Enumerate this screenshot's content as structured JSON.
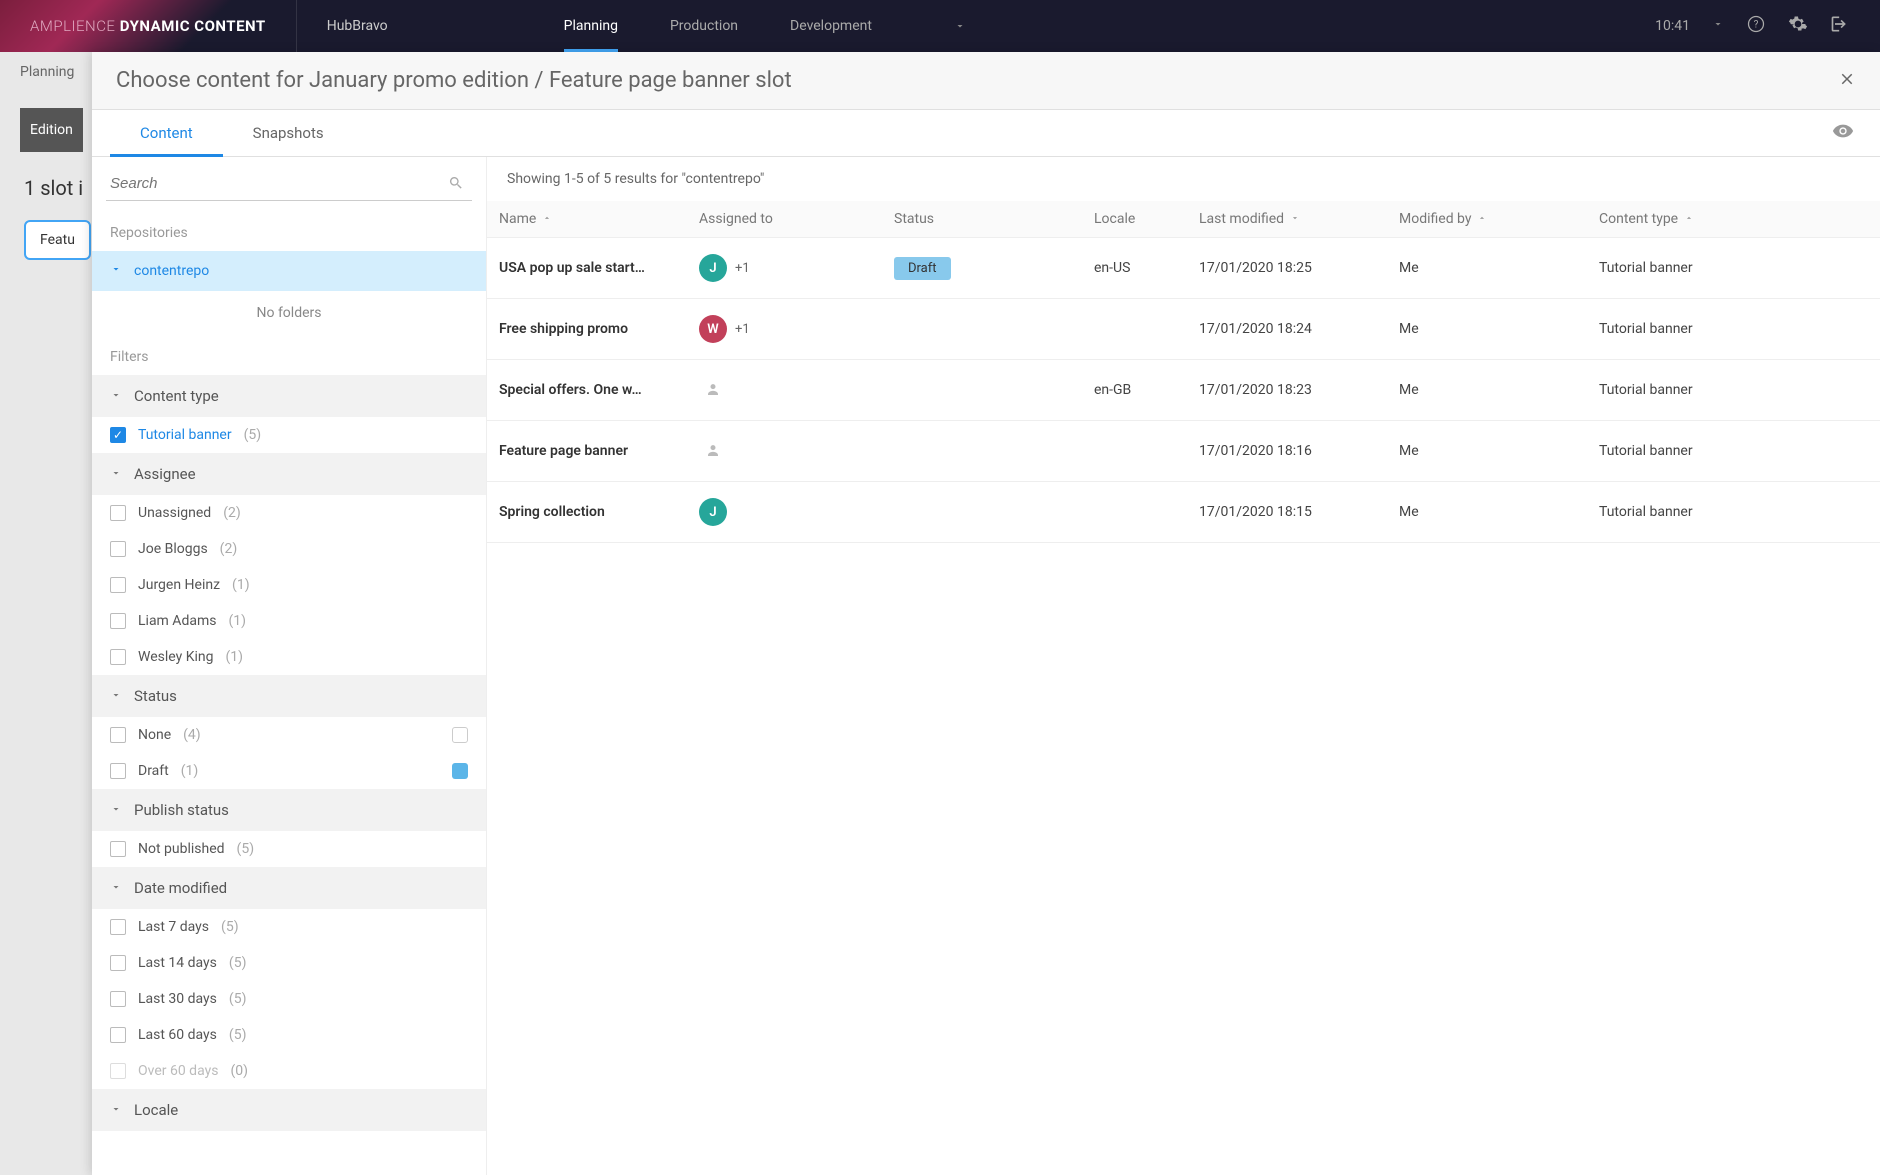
{
  "brand": {
    "light": "AMPLIENCE",
    "bold": "DYNAMIC CONTENT"
  },
  "hub": "HubBravo",
  "nav": {
    "planning": "Planning",
    "production": "Production",
    "development": "Development"
  },
  "clock": "10:41",
  "bg": {
    "planning": "Planning",
    "edition": "Edition",
    "slot_line": "1 slot i",
    "feature": "Featu"
  },
  "modal": {
    "title": "Choose content for January promo edition / Feature page banner slot",
    "tabs": {
      "content": "Content",
      "snapshots": "Snapshots"
    },
    "search_placeholder": "Search",
    "repos_label": "Repositories",
    "repo": "contentrepo",
    "no_folders": "No folders",
    "filters_label": "Filters",
    "sections": {
      "content_type": "Content type",
      "assignee": "Assignee",
      "status": "Status",
      "publish_status": "Publish status",
      "date_modified": "Date modified",
      "locale": "Locale"
    },
    "content_type_items": [
      {
        "label": "Tutorial banner",
        "count": "(5)",
        "selected": true
      }
    ],
    "assignee_items": [
      {
        "label": "Unassigned",
        "count": "(2)"
      },
      {
        "label": "Joe Bloggs",
        "count": "(2)"
      },
      {
        "label": "Jurgen Heinz",
        "count": "(1)"
      },
      {
        "label": "Liam Adams",
        "count": "(1)"
      },
      {
        "label": "Wesley King",
        "count": "(1)"
      }
    ],
    "status_items": [
      {
        "label": "None",
        "count": "(4)",
        "swatch": "none"
      },
      {
        "label": "Draft",
        "count": "(1)",
        "swatch": "draft"
      }
    ],
    "publish_items": [
      {
        "label": "Not published",
        "count": "(5)"
      }
    ],
    "date_items": [
      {
        "label": "Last 7 days",
        "count": "(5)"
      },
      {
        "label": "Last 14 days",
        "count": "(5)"
      },
      {
        "label": "Last 30 days",
        "count": "(5)"
      },
      {
        "label": "Last 60 days",
        "count": "(5)"
      },
      {
        "label": "Over 60 days",
        "count": "(0)",
        "dim": true
      }
    ],
    "results_header": "Showing 1-5 of 5 results for \"contentrepo\"",
    "columns": {
      "name": "Name",
      "assigned": "Assigned to",
      "status": "Status",
      "locale": "Locale",
      "last_mod": "Last modified",
      "mod_by": "Modified by",
      "content_type": "Content type"
    },
    "rows": [
      {
        "name": "USA pop up sale start…",
        "avatar": "J",
        "avclass": "av-J",
        "plus": "+1",
        "status": "Draft",
        "locale": "en-US",
        "mod": "17/01/2020 18:25",
        "by": "Me",
        "ct": "Tutorial banner"
      },
      {
        "name": "Free shipping promo",
        "avatar": "W",
        "avclass": "av-W",
        "plus": "+1",
        "status": "",
        "locale": "",
        "mod": "17/01/2020 18:24",
        "by": "Me",
        "ct": "Tutorial banner"
      },
      {
        "name": "Special offers. One w…",
        "avatar": "",
        "avclass": "av-empty",
        "plus": "",
        "status": "",
        "locale": "en-GB",
        "mod": "17/01/2020 18:23",
        "by": "Me",
        "ct": "Tutorial banner"
      },
      {
        "name": "Feature page banner",
        "avatar": "",
        "avclass": "av-empty",
        "plus": "",
        "status": "",
        "locale": "",
        "mod": "17/01/2020 18:16",
        "by": "Me",
        "ct": "Tutorial banner"
      },
      {
        "name": "Spring collection",
        "avatar": "J",
        "avclass": "av-J",
        "plus": "",
        "status": "",
        "locale": "",
        "mod": "17/01/2020 18:15",
        "by": "Me",
        "ct": "Tutorial banner"
      }
    ]
  }
}
